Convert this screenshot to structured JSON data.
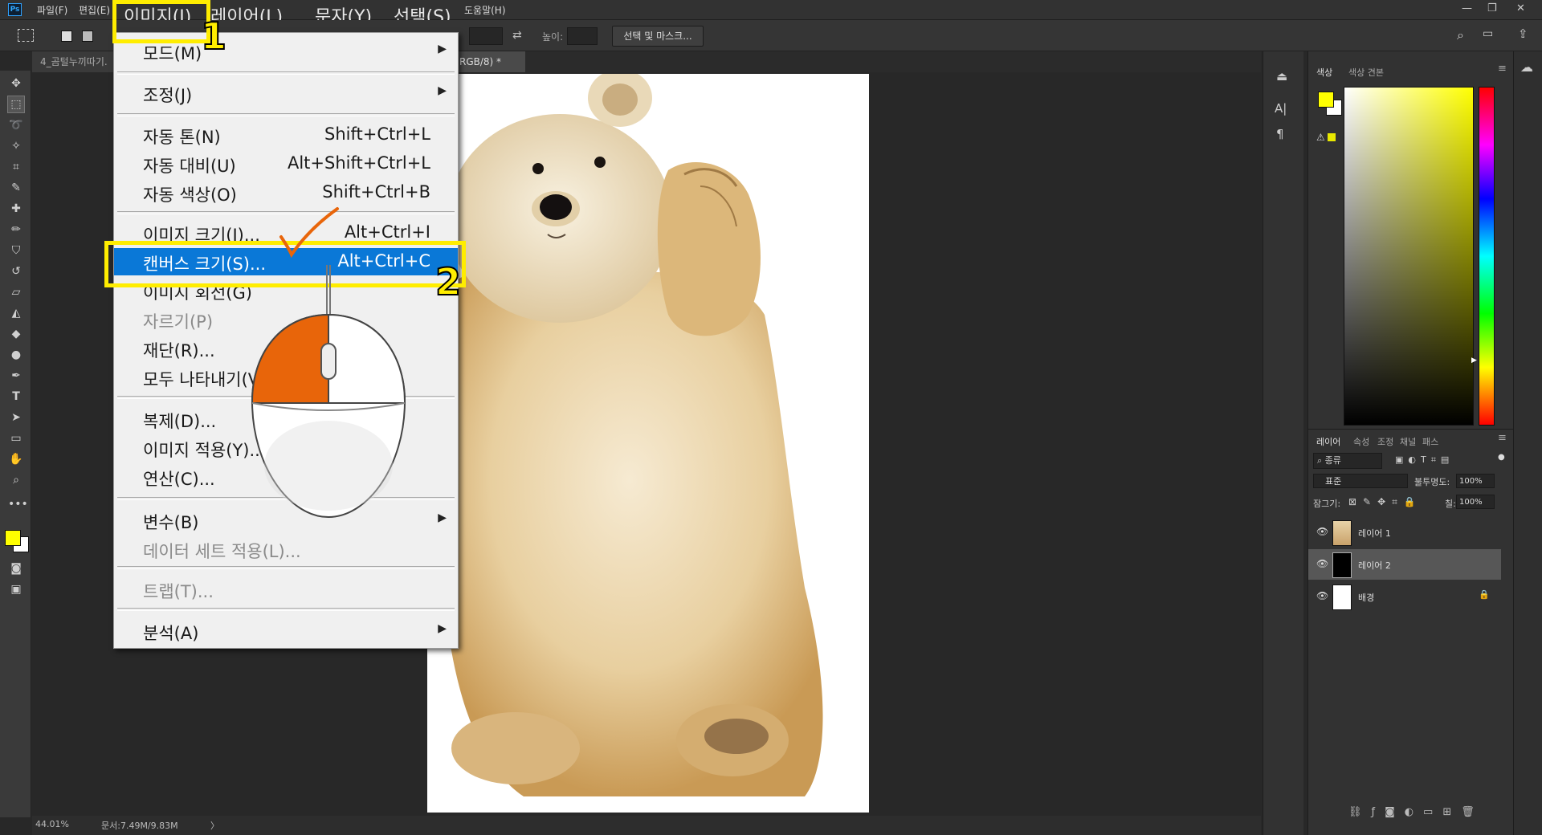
{
  "menubar": {
    "app_logo": "Ps",
    "items": [
      "파일(F)",
      "편집(E)",
      "이미지(I)",
      "레이어(L)",
      "문자(Y)",
      "선택(S)",
      "도움말(H)"
    ]
  },
  "optionsbar": {
    "height_label": "높이:",
    "select_mask_label": "선택 및 마스크..."
  },
  "tabs": {
    "doc1": "4_곰털누끼따기.",
    "doc2_suffix": "RGB/8) *",
    "close_glyph": "×"
  },
  "image_menu": {
    "items": [
      {
        "label": "모드(M)",
        "shortcut": "",
        "submenu": true,
        "disabled": false
      },
      {
        "label": "조정(J)",
        "shortcut": "",
        "submenu": true,
        "disabled": false
      },
      {
        "label": "자동 톤(N)",
        "shortcut": "Shift+Ctrl+L",
        "submenu": false,
        "disabled": false
      },
      {
        "label": "자동 대비(U)",
        "shortcut": "Alt+Shift+Ctrl+L",
        "submenu": false,
        "disabled": false
      },
      {
        "label": "자동 색상(O)",
        "shortcut": "Shift+Ctrl+B",
        "submenu": false,
        "disabled": false
      },
      {
        "label": "이미지 크기(I)...",
        "shortcut": "Alt+Ctrl+I",
        "submenu": false,
        "disabled": false
      },
      {
        "label": "캔버스 크기(S)...",
        "shortcut": "Alt+Ctrl+C",
        "submenu": false,
        "disabled": false,
        "highlighted": true
      },
      {
        "label": "이미지 회전(G)",
        "shortcut": "",
        "submenu": true,
        "disabled": false
      },
      {
        "label": "자르기(P)",
        "shortcut": "",
        "submenu": false,
        "disabled": true
      },
      {
        "label": "재단(R)...",
        "shortcut": "",
        "submenu": false,
        "disabled": false
      },
      {
        "label": "모두 나타내기(V)",
        "shortcut": "",
        "submenu": false,
        "disabled": false
      },
      {
        "label": "복제(D)...",
        "shortcut": "",
        "submenu": false,
        "disabled": false
      },
      {
        "label": "이미지 적용(Y)...",
        "shortcut": "",
        "submenu": false,
        "disabled": false
      },
      {
        "label": "연산(C)...",
        "shortcut": "",
        "submenu": false,
        "disabled": false
      },
      {
        "label": "변수(B)",
        "shortcut": "",
        "submenu": true,
        "disabled": false
      },
      {
        "label": "데이터 세트 적용(L)...",
        "shortcut": "",
        "submenu": false,
        "disabled": true
      },
      {
        "label": "트랩(T)...",
        "shortcut": "",
        "submenu": false,
        "disabled": true
      },
      {
        "label": "분석(A)",
        "shortcut": "",
        "submenu": true,
        "disabled": false
      }
    ],
    "submenu_arrow": "▶"
  },
  "steps": {
    "one": "1",
    "two": "2"
  },
  "color_panel": {
    "tabs": [
      "색상",
      "색상 견본"
    ],
    "foreground": "#ffff00",
    "background": "#ffffff"
  },
  "layers_panel": {
    "tabs": [
      "레이어",
      "속성",
      "조정",
      "채널",
      "패스"
    ],
    "filter_label": "종류",
    "blend_mode": "표준",
    "opacity_label": "불투명도:",
    "opacity_value": "100%",
    "lock_label": "잠그기:",
    "fill_label": "칠:",
    "fill_value": "100%",
    "layers": [
      {
        "name": "레이어 1",
        "selected": false,
        "thumb": "bear",
        "locked": false
      },
      {
        "name": "레이어 2",
        "selected": true,
        "thumb": "black",
        "locked": false
      },
      {
        "name": "배경",
        "selected": false,
        "thumb": "white",
        "locked": true
      }
    ]
  },
  "status": {
    "zoom": "44.01%",
    "doc_size": "문서:7.49M/9.83M",
    "arrow": "〉"
  },
  "colors": {
    "menu_highlight": "#0a78d7",
    "callout_yellow": "#ffed00",
    "mouse_button": "#e8650a"
  }
}
